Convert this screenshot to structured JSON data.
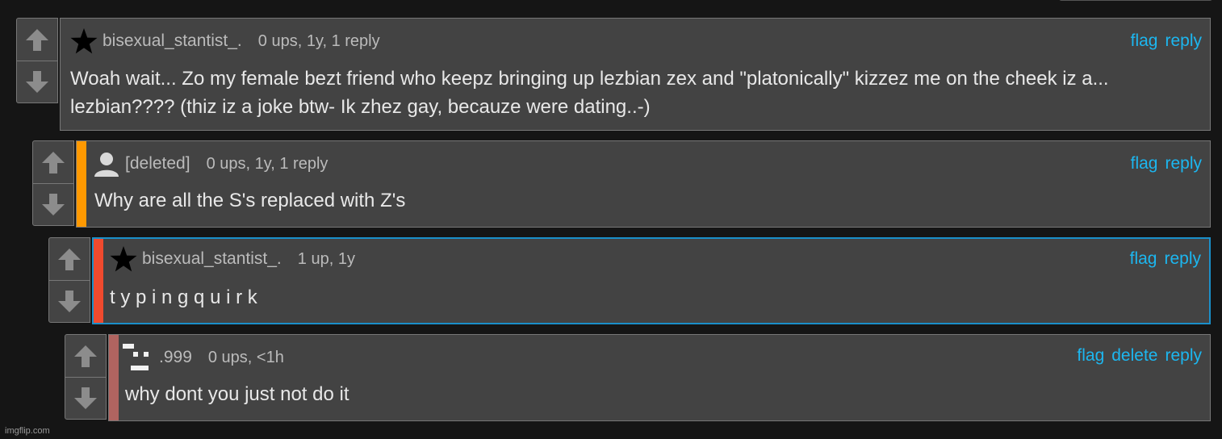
{
  "comments": [
    {
      "username": "bisexual_stantist_.",
      "stats": "0 ups, 1y, 1 reply",
      "actions": [
        "flag",
        "reply"
      ],
      "text": "Woah wait... Zo my female bezt friend who keepz bringing up lezbian zex and \"platonically\" kizzez me on the cheek iz a... lezbian???? (thiz iz a joke btw- Ik zhez gay, becauze were dating..-)",
      "avatar_icon": "star-icon",
      "stripe_color": null
    },
    {
      "username": "[deleted]",
      "stats": "0 ups, 1y, 1 reply",
      "actions": [
        "flag",
        "reply"
      ],
      "text": "Why are all the S's replaced with Z's",
      "avatar_icon": "default-user-icon",
      "stripe_color": "#ff9900"
    },
    {
      "username": "bisexual_stantist_.",
      "stats": "1 up, 1y",
      "actions": [
        "flag",
        "reply"
      ],
      "text": "t y p i n g q u i r k",
      "avatar_icon": "star-icon",
      "stripe_color": "#f04a2e"
    },
    {
      "username": ".999",
      "stats": "0 ups, <1h",
      "actions": [
        "flag",
        "delete",
        "reply"
      ],
      "text": "why dont you just not do it",
      "avatar_icon": "pixel-avatar-icon",
      "stripe_color": "#b06460"
    }
  ],
  "colors": {
    "link": "#1cb7f0",
    "selected_border": "#1a8fc9",
    "panel": "#434343",
    "background": "#151515"
  },
  "watermark": "imgflip.com"
}
